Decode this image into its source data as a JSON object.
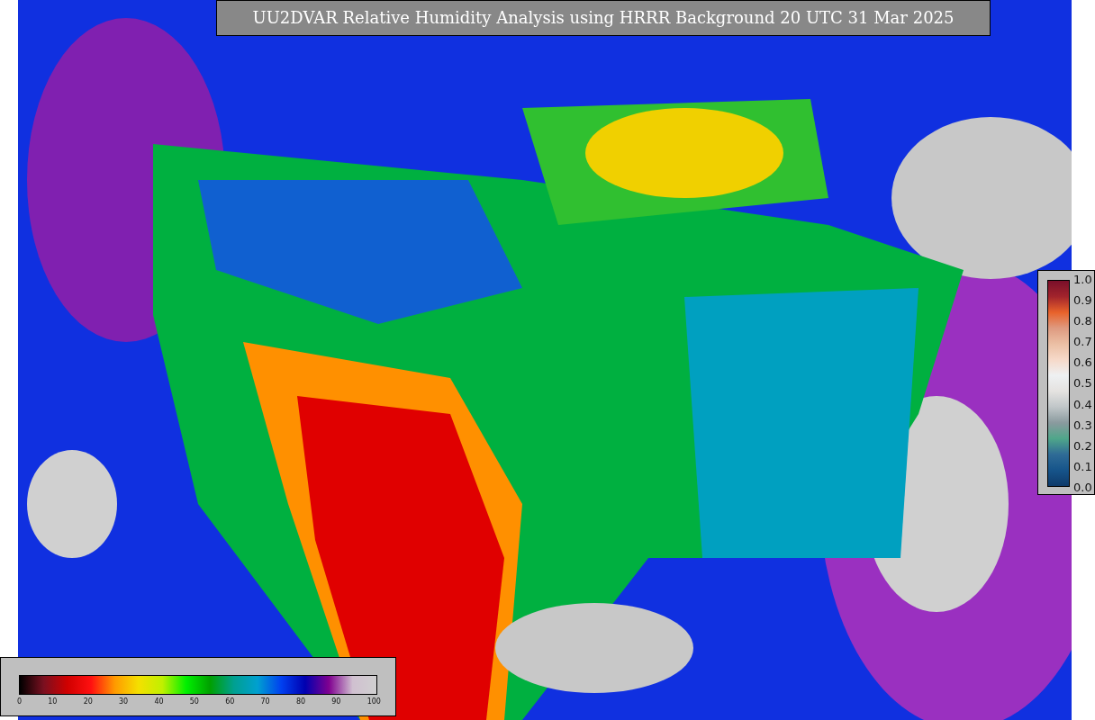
{
  "title": "UU2DVAR Relative Humidity Analysis using HRRR Background 20 UTC 31 Mar 2025",
  "observation_colorbar": {
    "ticks": [
      "1.0",
      "0.9",
      "0.8",
      "0.7",
      "0.6",
      "0.5",
      "0.4",
      "0.3",
      "0.2",
      "0.1",
      "0.0"
    ]
  },
  "humidity_colorbar": {
    "ticks": [
      "0",
      "10",
      "20",
      "30",
      "40",
      "50",
      "60",
      "70",
      "80",
      "90",
      "100"
    ]
  }
}
